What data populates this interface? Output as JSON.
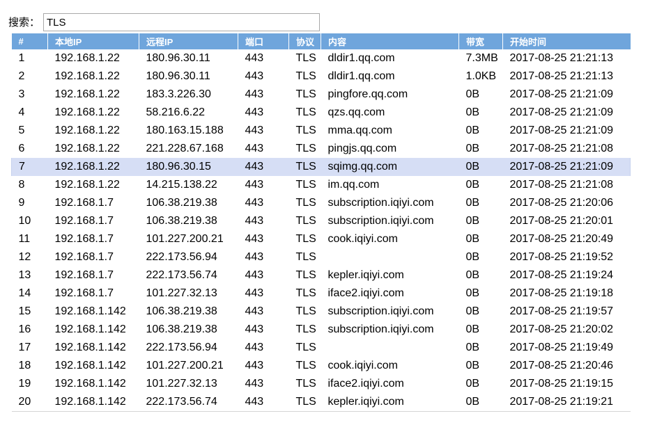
{
  "search": {
    "label": "搜索：",
    "value": "TLS"
  },
  "table": {
    "columns": [
      "#",
      "本地IP",
      "远程IP",
      "端口",
      "协议",
      "内容",
      "带宽",
      "开始时间"
    ],
    "selected_index": 6,
    "rows": [
      [
        "1",
        "192.168.1.22",
        "180.96.30.11",
        "443",
        "TLS",
        "dldir1.qq.com",
        "7.3MB",
        "2017-08-25 21:21:13"
      ],
      [
        "2",
        "192.168.1.22",
        "180.96.30.11",
        "443",
        "TLS",
        "dldir1.qq.com",
        "1.0KB",
        "2017-08-25 21:21:13"
      ],
      [
        "3",
        "192.168.1.22",
        "183.3.226.30",
        "443",
        "TLS",
        "pingfore.qq.com",
        "0B",
        "2017-08-25 21:21:09"
      ],
      [
        "4",
        "192.168.1.22",
        "58.216.6.22",
        "443",
        "TLS",
        "qzs.qq.com",
        "0B",
        "2017-08-25 21:21:09"
      ],
      [
        "5",
        "192.168.1.22",
        "180.163.15.188",
        "443",
        "TLS",
        "mma.qq.com",
        "0B",
        "2017-08-25 21:21:09"
      ],
      [
        "6",
        "192.168.1.22",
        "221.228.67.168",
        "443",
        "TLS",
        "pingjs.qq.com",
        "0B",
        "2017-08-25 21:21:08"
      ],
      [
        "7",
        "192.168.1.22",
        "180.96.30.15",
        "443",
        "TLS",
        "sqimg.qq.com",
        "0B",
        "2017-08-25 21:21:09"
      ],
      [
        "8",
        "192.168.1.22",
        "14.215.138.22",
        "443",
        "TLS",
        "im.qq.com",
        "0B",
        "2017-08-25 21:21:08"
      ],
      [
        "9",
        "192.168.1.7",
        "106.38.219.38",
        "443",
        "TLS",
        "subscription.iqiyi.com",
        "0B",
        "2017-08-25 21:20:06"
      ],
      [
        "10",
        "192.168.1.7",
        "106.38.219.38",
        "443",
        "TLS",
        "subscription.iqiyi.com",
        "0B",
        "2017-08-25 21:20:01"
      ],
      [
        "11",
        "192.168.1.7",
        "101.227.200.21",
        "443",
        "TLS",
        "cook.iqiyi.com",
        "0B",
        "2017-08-25 21:20:49"
      ],
      [
        "12",
        "192.168.1.7",
        "222.173.56.94",
        "443",
        "TLS",
        "",
        "0B",
        "2017-08-25 21:19:52"
      ],
      [
        "13",
        "192.168.1.7",
        "222.173.56.74",
        "443",
        "TLS",
        "kepler.iqiyi.com",
        "0B",
        "2017-08-25 21:19:24"
      ],
      [
        "14",
        "192.168.1.7",
        "101.227.32.13",
        "443",
        "TLS",
        "iface2.iqiyi.com",
        "0B",
        "2017-08-25 21:19:18"
      ],
      [
        "15",
        "192.168.1.142",
        "106.38.219.38",
        "443",
        "TLS",
        "subscription.iqiyi.com",
        "0B",
        "2017-08-25 21:19:57"
      ],
      [
        "16",
        "192.168.1.142",
        "106.38.219.38",
        "443",
        "TLS",
        "subscription.iqiyi.com",
        "0B",
        "2017-08-25 21:20:02"
      ],
      [
        "17",
        "192.168.1.142",
        "222.173.56.94",
        "443",
        "TLS",
        "",
        "0B",
        "2017-08-25 21:19:49"
      ],
      [
        "18",
        "192.168.1.142",
        "101.227.200.21",
        "443",
        "TLS",
        "cook.iqiyi.com",
        "0B",
        "2017-08-25 21:20:46"
      ],
      [
        "19",
        "192.168.1.142",
        "101.227.32.13",
        "443",
        "TLS",
        "iface2.iqiyi.com",
        "0B",
        "2017-08-25 21:19:15"
      ],
      [
        "20",
        "192.168.1.142",
        "222.173.56.74",
        "443",
        "TLS",
        "kepler.iqiyi.com",
        "0B",
        "2017-08-25 21:19:21"
      ]
    ]
  }
}
